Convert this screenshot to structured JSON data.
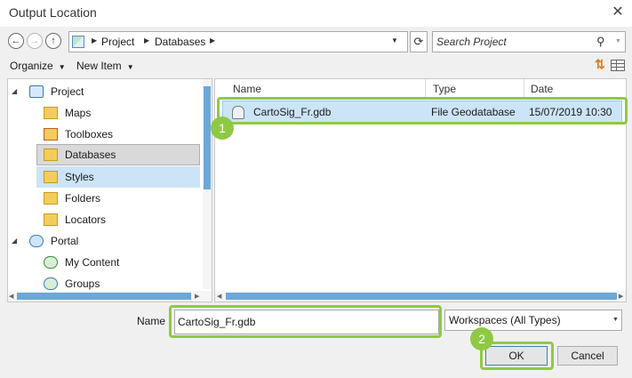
{
  "window": {
    "title": "Output Location",
    "close_glyph": "✕"
  },
  "nav": {
    "back_glyph": "←",
    "forward_glyph": "→",
    "up_glyph": "↑",
    "breadcrumbs": [
      "Project",
      "Databases"
    ],
    "crumb_sep": "▶",
    "dropdown_glyph": "▼",
    "refresh_glyph": "⟳"
  },
  "search": {
    "placeholder": "Search Project",
    "icon_glyph": "⚲",
    "dropdown_glyph": "▼"
  },
  "toolbar": {
    "organize": "Organize",
    "new_item": "New Item",
    "caret": "▼"
  },
  "tree": {
    "expanded_glyph": "◢",
    "items": [
      {
        "label": "Project",
        "expander": "◢",
        "icon": "project-folder-icon"
      },
      {
        "label": "Maps",
        "icon": "maps-folder-icon"
      },
      {
        "label": "Toolboxes",
        "icon": "toolboxes-folder-icon"
      },
      {
        "label": "Databases",
        "icon": "databases-folder-icon"
      },
      {
        "label": "Styles",
        "icon": "styles-folder-icon"
      },
      {
        "label": "Folders",
        "icon": "folders-folder-icon"
      },
      {
        "label": "Locators",
        "icon": "locators-folder-icon"
      },
      {
        "label": "Portal",
        "expander": "◢",
        "icon": "portal-cloud-icon"
      },
      {
        "label": "My Content",
        "icon": "my-content-icon"
      },
      {
        "label": "Groups",
        "icon": "groups-icon"
      }
    ]
  },
  "list": {
    "columns": [
      "Name",
      "Type",
      "Date"
    ],
    "rows": [
      {
        "name": "CartoSig_Fr.gdb",
        "type": "File Geodatabase",
        "date": "15/07/2019 10:30"
      }
    ]
  },
  "bottom": {
    "name_label": "Name",
    "name_value": "CartoSig_Fr.gdb",
    "filter_value": "Workspaces (All Types)",
    "filter_drop": "▼",
    "ok": "OK",
    "cancel": "Cancel"
  },
  "callouts": [
    "1",
    "2"
  ],
  "colors": {
    "highlight": "#8fc944",
    "selection": "#cce4f7",
    "scroll_thumb": "#6ca8d8"
  }
}
